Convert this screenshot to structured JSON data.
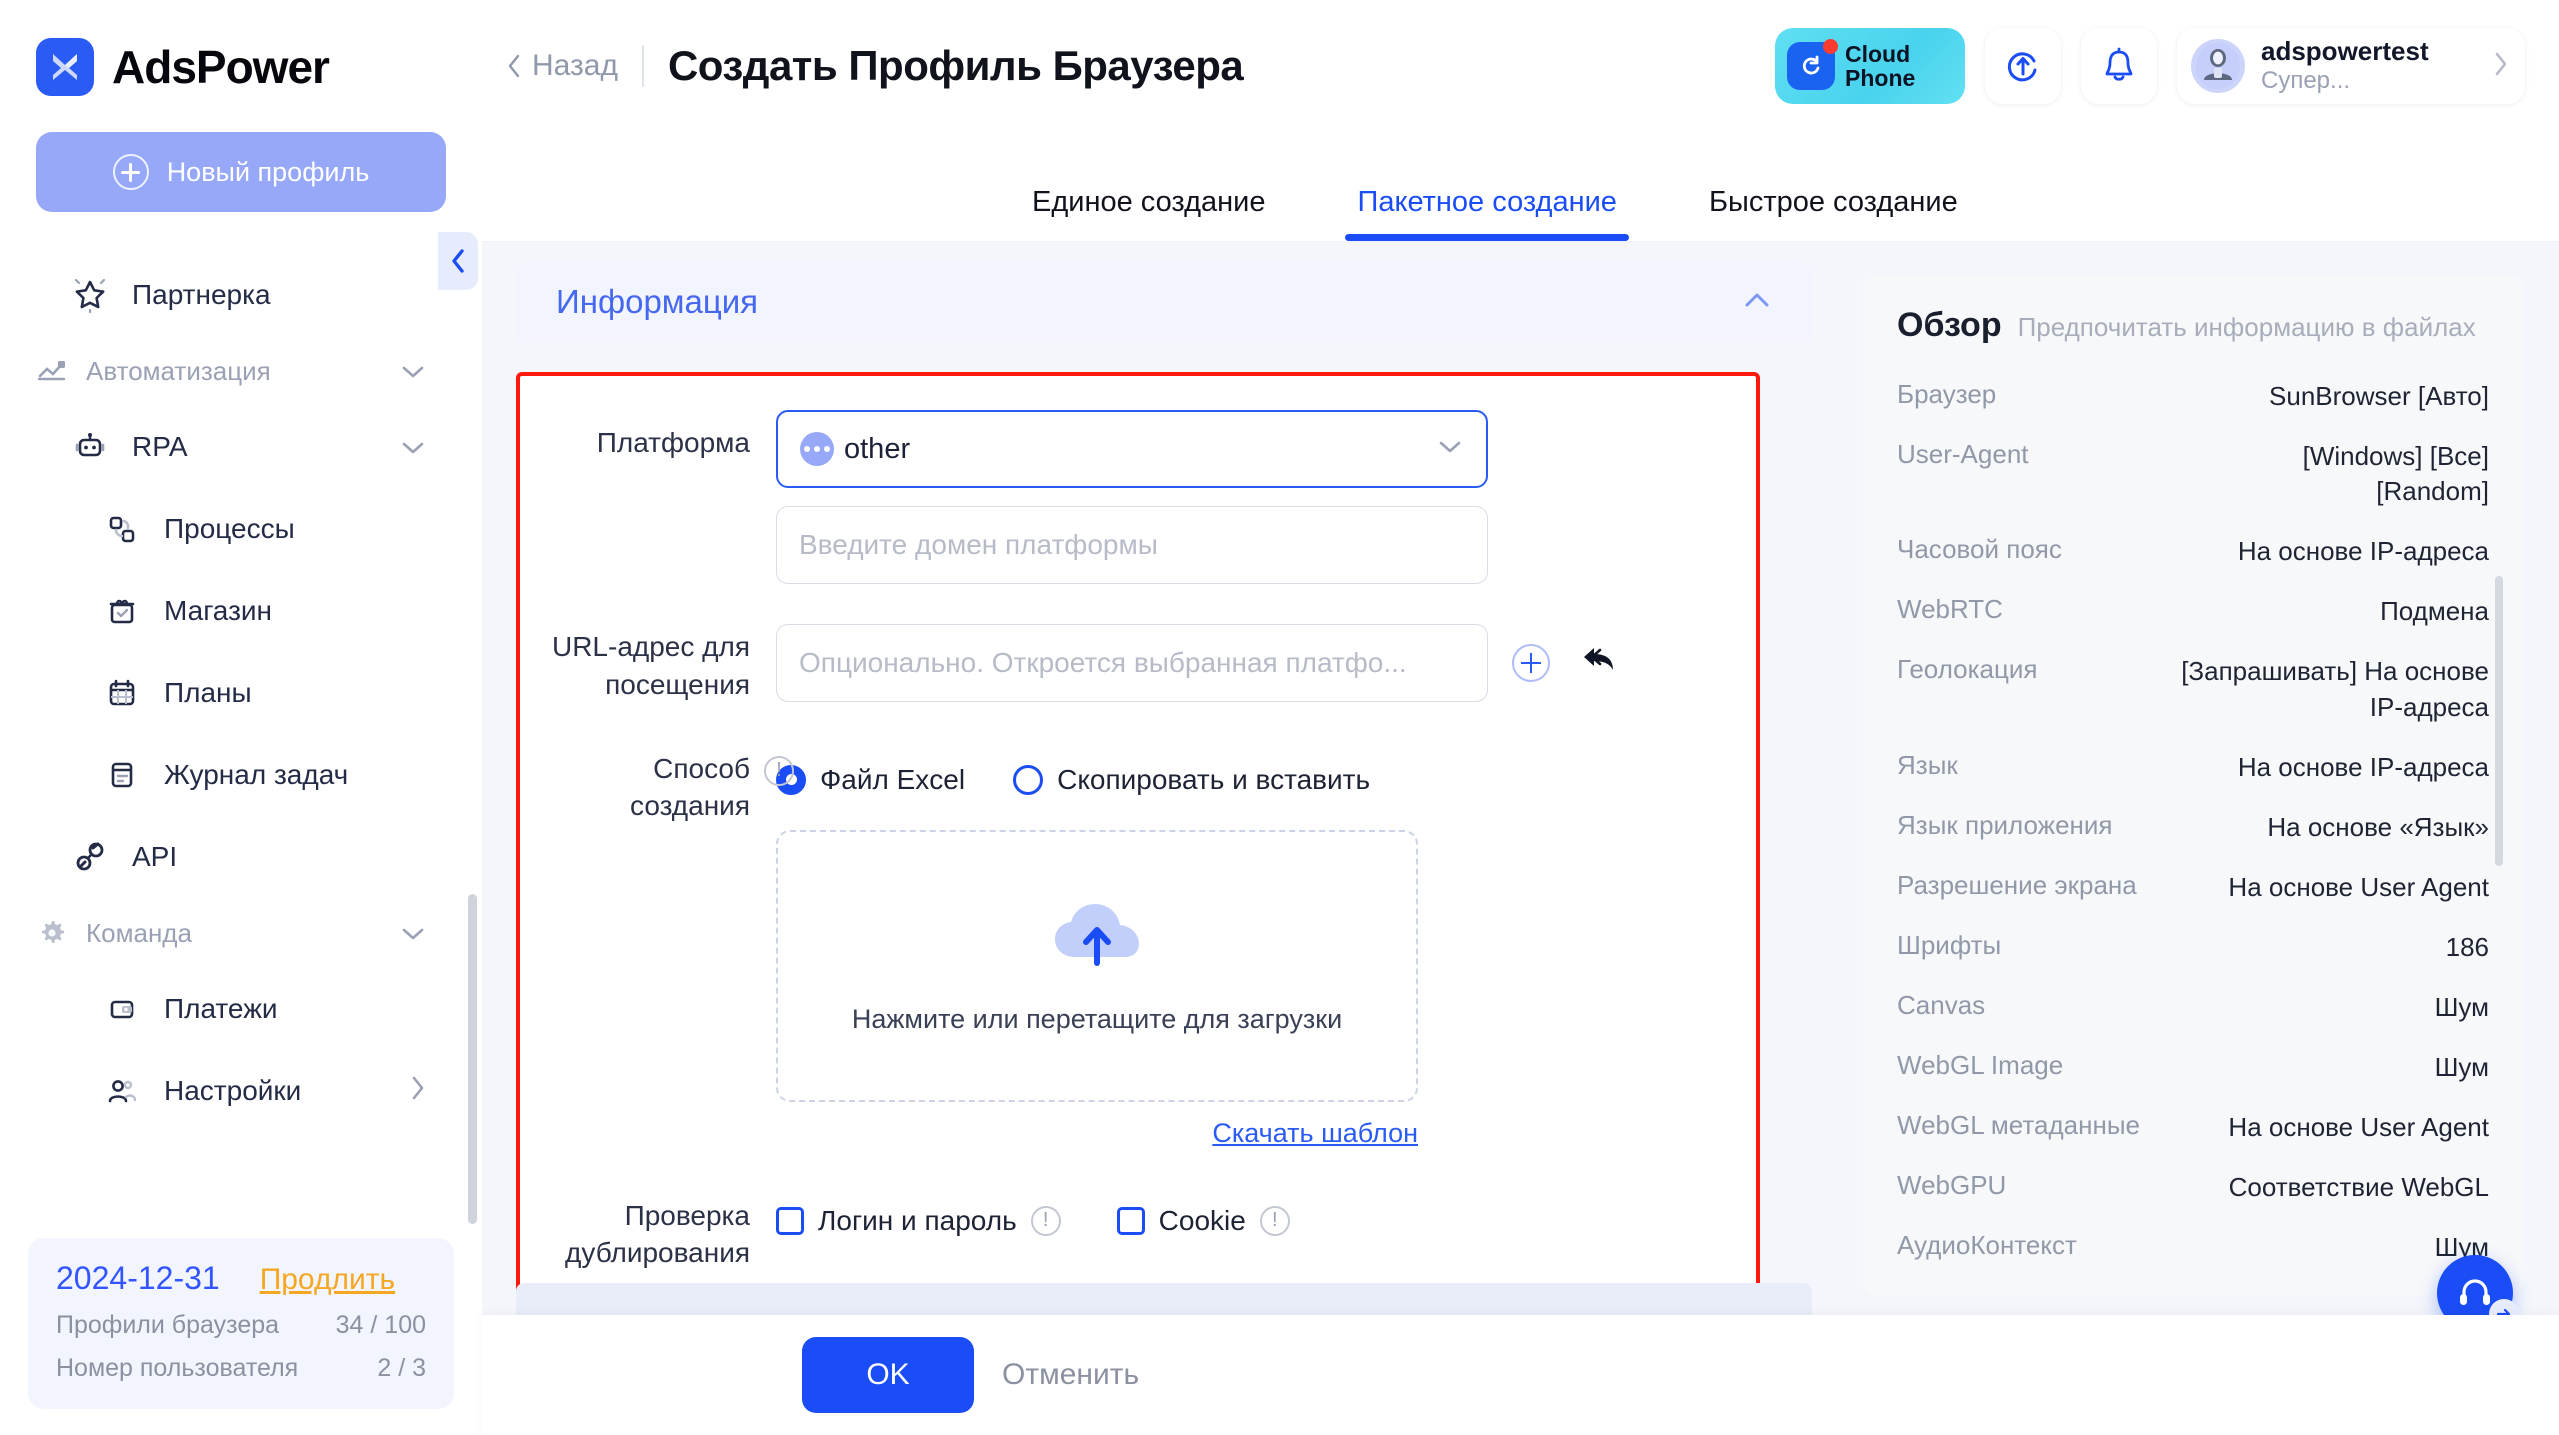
{
  "brand": {
    "name": "AdsPower",
    "logo_icon": "adspower-logo-icon"
  },
  "sidebar": {
    "new_profile_label": "Новый профиль",
    "collapse_icon": "chevron-left-icon",
    "items": [
      {
        "label": "Партнерка",
        "icon": "star-icon",
        "type": "item"
      },
      {
        "label": "Автоматизация",
        "icon": "automation-icon",
        "type": "group",
        "chevron": "chevron-down-icon"
      },
      {
        "label": "RPA",
        "icon": "robot-icon",
        "type": "item",
        "chevron": "chevron-down-icon"
      },
      {
        "label": "Процессы",
        "icon": "process-icon",
        "type": "sub"
      },
      {
        "label": "Магазин",
        "icon": "shop-icon",
        "type": "sub"
      },
      {
        "label": "Планы",
        "icon": "calendar-icon",
        "type": "sub"
      },
      {
        "label": "Журнал задач",
        "icon": "task-log-icon",
        "type": "sub"
      },
      {
        "label": "API",
        "icon": "api-plug-icon",
        "type": "item"
      },
      {
        "label": "Команда",
        "icon": "gear-icon",
        "type": "group",
        "chevron": "chevron-down-icon"
      },
      {
        "label": "Платежи",
        "icon": "wallet-icon",
        "type": "sub"
      },
      {
        "label": "Настройки",
        "icon": "users-icon",
        "type": "sub",
        "chevron": "chevron-right-icon"
      }
    ],
    "plan": {
      "date": "2024-12-31",
      "renew_label": "Продлить",
      "rows": [
        {
          "label": "Профили браузера",
          "value": "34 / 100"
        },
        {
          "label": "Номер пользователя",
          "value": "2 / 3"
        }
      ]
    }
  },
  "topbar": {
    "back_label": "Назад",
    "back_icon": "chevron-left-icon",
    "title": "Создать Профиль Браузера",
    "cloud_phone": {
      "line1": "Cloud",
      "line2": "Phone",
      "icon": "cloud-phone-icon"
    },
    "sync_icon": "sync-icon",
    "bell_icon": "bell-icon",
    "user": {
      "name": "adspowertest",
      "role": "Супер...",
      "avatar_icon": "avatar-icon",
      "chevron": "chevron-right-icon"
    }
  },
  "tabs": [
    {
      "label": "Единое создание",
      "active": false
    },
    {
      "label": "Пакетное создание",
      "active": true
    },
    {
      "label": "Быстрое создание",
      "active": false
    }
  ],
  "form": {
    "section_title": "Информация",
    "section_collapse_icon": "chevron-up-icon",
    "platform": {
      "label": "Платформа",
      "value": "other",
      "value_icon": "ellipsis-circle-icon",
      "caret_icon": "chevron-down-icon",
      "domain_placeholder": "Введите домен платформы",
      "domain_value": ""
    },
    "url": {
      "label": "URL-адрес для посещения",
      "placeholder": "Опционально. Откроется выбранная платфо...",
      "value": "",
      "add_icon": "plus-circle-icon",
      "undo_icon": "undo-arrow-icon"
    },
    "creation_method": {
      "label": "Способ создания",
      "info_icon": "info-icon",
      "options": [
        {
          "label": "Файл Excel",
          "selected": true
        },
        {
          "label": "Скопировать и вставить",
          "selected": false
        }
      ]
    },
    "upload": {
      "icon": "cloud-upload-icon",
      "text": "Нажмите или перетащите для загрузки",
      "template_link": "Скачать шаблон"
    },
    "duplicate_check": {
      "label": "Проверка дублирования",
      "options": [
        {
          "label": "Логин и пароль",
          "checked": false,
          "info_icon": "info-icon"
        },
        {
          "label": "Cookie",
          "checked": false,
          "info_icon": "info-icon"
        }
      ]
    }
  },
  "footer": {
    "ok_label": "OK",
    "cancel_label": "Отменить"
  },
  "overview": {
    "title": "Обзор",
    "subtitle": "Предпочитать информацию в файлах",
    "rows": [
      {
        "key": "Браузер",
        "value": "SunBrowser [Авто]"
      },
      {
        "key": "User-Agent",
        "value": "[Windows] [Все] [Random]"
      },
      {
        "key": "Часовой пояс",
        "value": "На основе IP-адреса"
      },
      {
        "key": "WebRTC",
        "value": "Подмена"
      },
      {
        "key": "Геолокация",
        "value": "[Запрашивать] На основе IP-адреса"
      },
      {
        "key": "Язык",
        "value": "На основе IP-адреса"
      },
      {
        "key": "Язык приложения",
        "value": "На основе «Язык»"
      },
      {
        "key": "Разрешение экрана",
        "value": "На основе User Agent"
      },
      {
        "key": "Шрифты",
        "value": "186"
      },
      {
        "key": "Canvas",
        "value": "Шум"
      },
      {
        "key": "WebGL Image",
        "value": "Шум"
      },
      {
        "key": "WebGL метаданные",
        "value": "На основе User Agent"
      },
      {
        "key": "WebGPU",
        "value": "Соответствие WebGL"
      },
      {
        "key": "АудиоКонтекст",
        "value": "Шум"
      }
    ]
  },
  "support": {
    "icon": "headset-icon",
    "arrow_icon": "arrow-right-icon"
  },
  "colors": {
    "accent": "#1a4df5",
    "brand": "#2a5bf5",
    "highlight_box": "#fb1a0d",
    "renew": "#f5a623"
  }
}
